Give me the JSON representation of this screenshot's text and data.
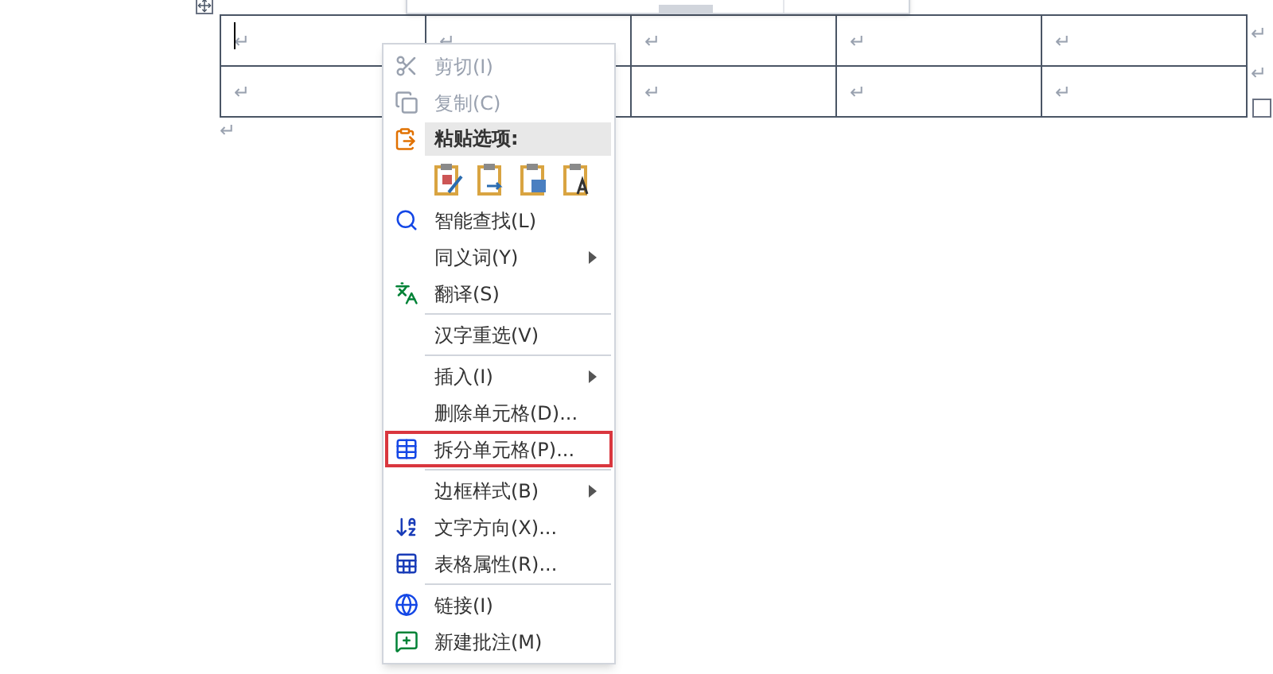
{
  "table": {
    "rows": [
      [
        "↵",
        "↵",
        "↵",
        "↵",
        "↵"
      ],
      [
        "↵",
        null,
        "↵",
        "↵",
        "↵"
      ]
    ],
    "row_end_marks": [
      "↵",
      "↵"
    ]
  },
  "after_table_mark": "↵",
  "context_menu": {
    "items": [
      {
        "kind": "item",
        "label": "剪切(I)",
        "disabled": true,
        "submenu": false,
        "highlighted": false
      },
      {
        "kind": "item",
        "label": "复制(C)",
        "disabled": true,
        "submenu": false,
        "highlighted": false
      },
      {
        "kind": "header",
        "label": "粘贴选项:"
      },
      {
        "kind": "paste_options"
      },
      {
        "kind": "item",
        "label": "智能查找(L)",
        "disabled": false,
        "submenu": false,
        "highlighted": false
      },
      {
        "kind": "item",
        "label": "同义词(Y)",
        "disabled": false,
        "submenu": true,
        "highlighted": false
      },
      {
        "kind": "item",
        "label": "翻译(S)",
        "disabled": false,
        "submenu": false,
        "highlighted": false
      },
      {
        "kind": "separator"
      },
      {
        "kind": "item",
        "label": "汉字重选(V)",
        "disabled": false,
        "submenu": false,
        "highlighted": false
      },
      {
        "kind": "separator"
      },
      {
        "kind": "item",
        "label": "插入(I)",
        "disabled": false,
        "submenu": true,
        "highlighted": false
      },
      {
        "kind": "item",
        "label": "删除单元格(D)...",
        "disabled": false,
        "submenu": false,
        "highlighted": false
      },
      {
        "kind": "item",
        "label": "拆分单元格(P)...",
        "disabled": false,
        "submenu": false,
        "highlighted": true
      },
      {
        "kind": "separator"
      },
      {
        "kind": "item",
        "label": "边框样式(B)",
        "disabled": false,
        "submenu": true,
        "highlighted": false
      },
      {
        "kind": "item",
        "label": "文字方向(X)...",
        "disabled": false,
        "submenu": false,
        "highlighted": false
      },
      {
        "kind": "item",
        "label": "表格属性(R)...",
        "disabled": false,
        "submenu": false,
        "highlighted": false
      },
      {
        "kind": "separator"
      },
      {
        "kind": "item",
        "label": "链接(I)",
        "disabled": false,
        "submenu": false,
        "highlighted": false
      },
      {
        "kind": "item",
        "label": "新建批注(M)",
        "disabled": false,
        "submenu": false,
        "highlighted": false
      }
    ]
  }
}
